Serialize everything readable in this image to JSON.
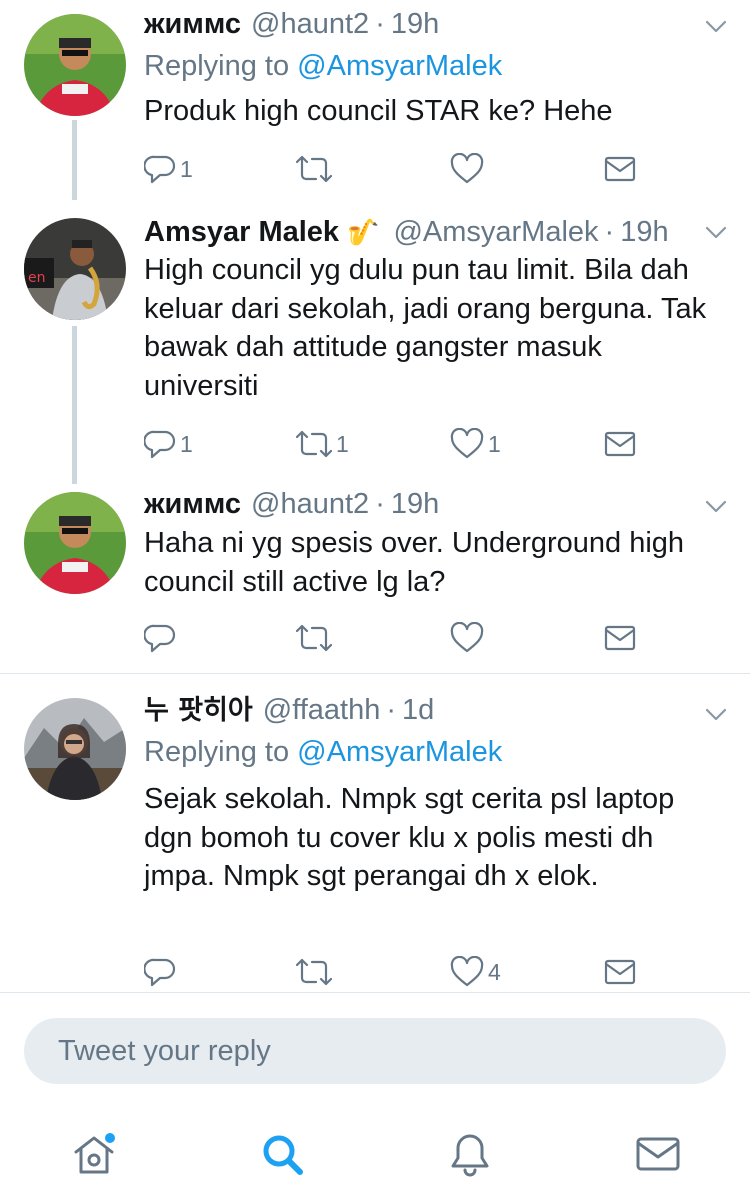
{
  "tweets": [
    {
      "name": "жиммс",
      "handle": "@haunt2",
      "time": "19h",
      "replying_label": "Replying to",
      "replying_to": "@AmsyarMalek",
      "text": "Produk high council STAR ke? Hehe",
      "reply_count": "1",
      "retweet_count": "",
      "like_count": "",
      "liked": false
    },
    {
      "name": "Amsyar Malek",
      "badge": "🎷",
      "handle": "@AmsyarMalek",
      "time": "19h",
      "text": "High council yg dulu pun tau limit. Bila dah keluar dari sekolah, jadi orang berguna. Tak bawak dah attitude gangster masuk universiti",
      "reply_count": "1",
      "retweet_count": "1",
      "like_count": "1",
      "liked": false
    },
    {
      "name": "жиммс",
      "handle": "@haunt2",
      "time": "19h",
      "text": "Haha ni yg spesis over. Underground high council still active lg la?",
      "reply_count": "",
      "retweet_count": "",
      "like_count": "",
      "liked": false
    },
    {
      "name": "누 팟히아",
      "handle": "@ffaathh",
      "time": "1d",
      "replying_label": "Replying to",
      "replying_to": "@AmsyarMalek",
      "text": "Sejak sekolah. Nmpk sgt cerita psl laptop dgn bomoh tu cover klu x polis mesti dh jmpa. Nmpk sgt perangai dh x elok.",
      "reply_count": "",
      "retweet_count": "",
      "like_count": "4",
      "liked": false
    }
  ],
  "separator": "·",
  "reply_box": {
    "placeholder": "Tweet your reply"
  },
  "tabbar": {
    "items": [
      "home-icon",
      "search-icon",
      "notifications-icon",
      "messages-icon"
    ],
    "active": "search-icon",
    "home_has_dot": true
  },
  "colors": {
    "accent": "#1da1f2",
    "mention": "#1b95e0",
    "secondary_text": "#657786",
    "icon_gray": "#657786",
    "divider": "#e1e8ed",
    "thread_line": "#ccd6dd",
    "reply_box_bg": "#e6ecf0"
  }
}
